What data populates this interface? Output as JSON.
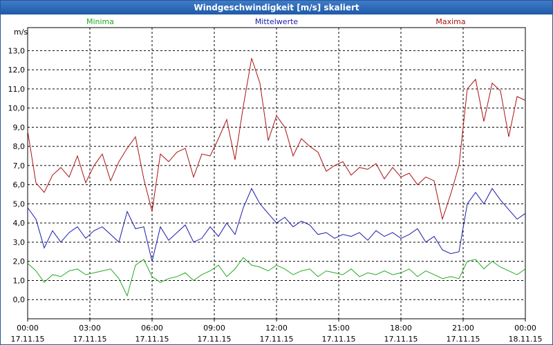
{
  "chart_data": {
    "type": "line",
    "title": "Windgeschwindigkeit [m/s] skaliert",
    "ylabel": "m/s",
    "xlabel": "",
    "ylim": [
      -1,
      14.2
    ],
    "xlim": [
      0,
      24
    ],
    "grid": true,
    "legend_placement": "top",
    "y_ticks": [
      "0,0",
      "1,0",
      "2,0",
      "3,0",
      "4,0",
      "5,0",
      "6,0",
      "7,0",
      "8,0",
      "9,0",
      "10,0",
      "11,0",
      "12,0",
      "13,0"
    ],
    "y_tick_values": [
      0,
      1,
      2,
      3,
      4,
      5,
      6,
      7,
      8,
      9,
      10,
      11,
      12,
      13
    ],
    "x_tick_values": [
      0,
      3,
      6,
      9,
      12,
      15,
      18,
      21,
      24
    ],
    "x_ticks": [
      {
        "time": "00:00",
        "date": "17.11.15"
      },
      {
        "time": "03:00",
        "date": "17.11.15"
      },
      {
        "time": "06:00",
        "date": "17.11.15"
      },
      {
        "time": "09:00",
        "date": "17.11.15"
      },
      {
        "time": "12:00",
        "date": "17.11.15"
      },
      {
        "time": "15:00",
        "date": "17.11.15"
      },
      {
        "time": "18:00",
        "date": "17.11.15"
      },
      {
        "time": "21:00",
        "date": "17.11.15"
      },
      {
        "time": "00:00",
        "date": "18.11.15"
      }
    ],
    "series": [
      {
        "name": "Minima",
        "color": "#22aa22",
        "x": [
          0,
          0.4,
          0.8,
          1.2,
          1.6,
          2.0,
          2.4,
          2.8,
          3.2,
          3.6,
          4.0,
          4.4,
          4.8,
          5.2,
          5.6,
          6.0,
          6.4,
          6.8,
          7.2,
          7.6,
          8.0,
          8.4,
          8.8,
          9.2,
          9.6,
          10.0,
          10.4,
          10.8,
          11.2,
          11.6,
          12.0,
          12.4,
          12.8,
          13.2,
          13.6,
          14.0,
          14.4,
          14.8,
          15.2,
          15.6,
          16.0,
          16.4,
          16.8,
          17.2,
          17.6,
          18.0,
          18.4,
          18.8,
          19.2,
          19.6,
          20.0,
          20.4,
          20.8,
          21.2,
          21.6,
          22.0,
          22.4,
          22.8,
          23.2,
          23.6,
          24.0
        ],
        "values": [
          1.9,
          1.5,
          0.9,
          1.3,
          1.2,
          1.5,
          1.6,
          1.3,
          1.4,
          1.5,
          1.6,
          1.1,
          0.2,
          1.8,
          2.1,
          1.2,
          0.9,
          1.1,
          1.2,
          1.4,
          1.0,
          1.3,
          1.5,
          1.8,
          1.2,
          1.6,
          2.2,
          1.8,
          1.7,
          1.5,
          1.8,
          1.6,
          1.3,
          1.5,
          1.6,
          1.2,
          1.5,
          1.4,
          1.3,
          1.6,
          1.2,
          1.4,
          1.3,
          1.5,
          1.3,
          1.4,
          1.6,
          1.2,
          1.5,
          1.3,
          1.1,
          1.2,
          1.1,
          2.0,
          2.1,
          1.6,
          2.0,
          1.7,
          1.5,
          1.3,
          1.6
        ]
      },
      {
        "name": "Mittelwerte",
        "color": "#1a1aaa",
        "x": [
          0,
          0.4,
          0.8,
          1.2,
          1.6,
          2.0,
          2.4,
          2.8,
          3.2,
          3.6,
          4.0,
          4.4,
          4.8,
          5.2,
          5.6,
          6.0,
          6.4,
          6.8,
          7.2,
          7.6,
          8.0,
          8.4,
          8.8,
          9.2,
          9.6,
          10.0,
          10.4,
          10.8,
          11.2,
          11.6,
          12.0,
          12.4,
          12.8,
          13.2,
          13.6,
          14.0,
          14.4,
          14.8,
          15.2,
          15.6,
          16.0,
          16.4,
          16.8,
          17.2,
          17.6,
          18.0,
          18.4,
          18.8,
          19.2,
          19.6,
          20.0,
          20.4,
          20.8,
          21.2,
          21.6,
          22.0,
          22.4,
          22.8,
          23.2,
          23.6,
          24.0
        ],
        "values": [
          4.8,
          4.2,
          2.7,
          3.6,
          3.0,
          3.5,
          3.8,
          3.2,
          3.6,
          3.8,
          3.4,
          3.0,
          4.6,
          3.7,
          3.8,
          2.0,
          3.8,
          3.1,
          3.5,
          3.9,
          3.0,
          3.2,
          3.8,
          3.3,
          4.0,
          3.4,
          4.8,
          5.8,
          5.0,
          4.5,
          4.0,
          4.3,
          3.8,
          4.1,
          3.9,
          3.4,
          3.5,
          3.2,
          3.4,
          3.3,
          3.5,
          3.1,
          3.6,
          3.3,
          3.5,
          3.2,
          3.4,
          3.7,
          3.0,
          3.3,
          2.6,
          2.4,
          2.5,
          5.0,
          5.6,
          5.0,
          5.8,
          5.2,
          4.7,
          4.2,
          4.5
        ]
      },
      {
        "name": "Maxima",
        "color": "#aa1111",
        "x": [
          0,
          0.4,
          0.8,
          1.2,
          1.6,
          2.0,
          2.4,
          2.8,
          3.2,
          3.6,
          4.0,
          4.4,
          4.8,
          5.2,
          5.6,
          6.0,
          6.4,
          6.8,
          7.2,
          7.6,
          8.0,
          8.4,
          8.8,
          9.2,
          9.6,
          10.0,
          10.4,
          10.8,
          11.2,
          11.6,
          12.0,
          12.4,
          12.8,
          13.2,
          13.6,
          14.0,
          14.4,
          14.8,
          15.2,
          15.6,
          16.0,
          16.4,
          16.8,
          17.2,
          17.6,
          18.0,
          18.4,
          18.8,
          19.2,
          19.6,
          20.0,
          20.4,
          20.8,
          21.2,
          21.6,
          22.0,
          22.4,
          22.8,
          23.2,
          23.6,
          24.0
        ],
        "values": [
          8.8,
          6.1,
          5.6,
          6.5,
          6.9,
          6.4,
          7.5,
          6.1,
          7.0,
          7.6,
          6.2,
          7.2,
          7.9,
          8.5,
          6.3,
          4.6,
          7.6,
          7.2,
          7.7,
          7.9,
          6.4,
          7.6,
          7.5,
          8.4,
          9.4,
          7.3,
          10.1,
          12.6,
          11.3,
          8.3,
          9.6,
          9.0,
          7.5,
          8.4,
          8.0,
          7.7,
          6.7,
          7.0,
          7.2,
          6.5,
          6.9,
          6.8,
          7.1,
          6.3,
          6.9,
          6.4,
          6.6,
          6.0,
          6.4,
          6.2,
          4.2,
          5.5,
          7.0,
          11.0,
          11.5,
          9.3,
          11.3,
          10.9,
          8.5,
          10.6,
          10.4
        ]
      }
    ]
  }
}
